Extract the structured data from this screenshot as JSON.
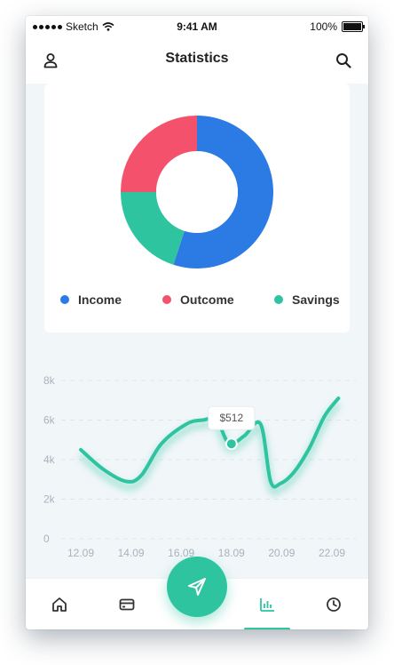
{
  "status_bar": {
    "carrier": "Sketch",
    "time": "9:41 AM",
    "battery": "100%"
  },
  "header": {
    "title": "Statistics",
    "left_icon": "user-icon",
    "right_icon": "search-icon"
  },
  "chart_data": [
    {
      "type": "pie",
      "style": "donut",
      "title": "",
      "series": [
        {
          "name": "Income",
          "value": 55,
          "color": "#2c7be5"
        },
        {
          "name": "Savings",
          "value": 20,
          "color": "#2ec4a0"
        },
        {
          "name": "Outcome",
          "value": 25,
          "color": "#f4516c"
        }
      ],
      "legend": [
        {
          "label": "Income",
          "color": "#2c7be5"
        },
        {
          "label": "Outcome",
          "color": "#f4516c"
        },
        {
          "label": "Savings",
          "color": "#2ec4a0"
        }
      ]
    },
    {
      "type": "line",
      "title": "",
      "xlabel": "",
      "ylabel": "",
      "x_ticks": [
        "12.09",
        "14.09",
        "16.09",
        "18.09",
        "20.09",
        "22.09"
      ],
      "y_ticks": [
        "0",
        "2k",
        "4k",
        "6k",
        "8k"
      ],
      "ylim": [
        0,
        8000
      ],
      "grid": true,
      "series": [
        {
          "color": "#2ec4a0",
          "x": [
            12.09,
            13.0,
            13.9,
            14.5,
            15.3,
            16.3,
            16.95,
            17.5,
            18.0,
            18.6,
            19.25,
            19.65,
            20.05,
            20.6,
            21.2,
            21.8,
            22.35
          ],
          "y": [
            4500,
            3500,
            2900,
            3200,
            4800,
            5800,
            6000,
            6000,
            4800,
            5200,
            5800,
            2900,
            2800,
            3400,
            4600,
            6200,
            7100
          ]
        }
      ],
      "annotation": {
        "x": 18.09,
        "y": 4800,
        "label": "$512"
      }
    }
  ],
  "tab_bar": {
    "tabs": [
      {
        "name": "home",
        "icon": "home-icon"
      },
      {
        "name": "cards",
        "icon": "credit-card-icon"
      },
      {
        "name": "send",
        "icon": "send-icon"
      },
      {
        "name": "statistics",
        "icon": "bar-chart-icon",
        "active": true
      },
      {
        "name": "history",
        "icon": "clock-icon"
      }
    ],
    "accent_color": "#2ec4a0"
  }
}
